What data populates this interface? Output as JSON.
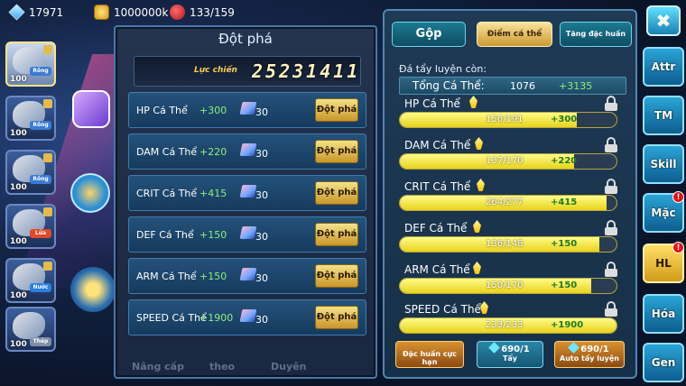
{
  "resources": {
    "diamonds": "17971",
    "gold": "1000000k",
    "stamina": "133/159"
  },
  "roster": [
    {
      "level": "100",
      "type": "Rồng",
      "type_color": "#3a7bd5",
      "element_color": "#e94bd0",
      "selected": true
    },
    {
      "level": "100",
      "type": "Rồng",
      "type_color": "#3a7bd5",
      "element_color": "#ffcc33",
      "selected": false
    },
    {
      "level": "100",
      "type": "Rồng",
      "type_color": "#3a7bd5",
      "element_color": "#e94bd0",
      "selected": false
    },
    {
      "level": "100",
      "type": "Lửa",
      "type_color": "#e04a2a",
      "element_color": "#ffcc33",
      "selected": false
    },
    {
      "level": "100",
      "type": "Nước",
      "type_color": "#2a7fe0",
      "element_color": "#ffcc33",
      "selected": false
    },
    {
      "level": "100",
      "type": "Thép",
      "type_color": "#7f8fa6",
      "element_color": "#ffcc33",
      "selected": false
    }
  ],
  "dot_pha": {
    "title": "Đột phá",
    "power_label": "Lực chiến",
    "power_value": "25231411",
    "rows": [
      {
        "name": "HP Cá Thể",
        "bonus": "+300",
        "cost": "30",
        "button": "Đột phá"
      },
      {
        "name": "DAM Cá Thể",
        "bonus": "+220",
        "cost": "30",
        "button": "Đột phá"
      },
      {
        "name": "CRIT Cá Thể",
        "bonus": "+415",
        "cost": "30",
        "button": "Đột phá"
      },
      {
        "name": "DEF Cá Thể",
        "bonus": "+150",
        "cost": "30",
        "button": "Đột phá"
      },
      {
        "name": "ARM Cá Thể",
        "bonus": "+150",
        "cost": "30",
        "button": "Đột phá"
      },
      {
        "name": "SPEED Cá Thể",
        "bonus": "+1900",
        "cost": "30",
        "button": "Đột phá"
      }
    ],
    "bottom_tabs": [
      "Nâng cấp",
      "theo",
      "Duyên"
    ]
  },
  "right_panel": {
    "tabs": [
      "Gộp",
      "Điểm cá thể",
      "Tăng đặc huấn"
    ],
    "active_tab": 1,
    "remaining_label": "Đá tẩy luyện còn:",
    "total_label": "Tổng Cá Thể:",
    "total_value": "1076",
    "total_plus": "+3135",
    "stats": [
      {
        "name": "HP Cá Thể",
        "progress": "156/191",
        "current": 156,
        "max": 191,
        "plus": "+300"
      },
      {
        "name": "DAM Cá Thể",
        "progress": "137/170",
        "current": 137,
        "max": 170,
        "plus": "+220"
      },
      {
        "name": "CRIT Cá Thể",
        "progress": "264/277",
        "current": 264,
        "max": 277,
        "plus": "+415"
      },
      {
        "name": "DEF Cá Thể",
        "progress": "136/148",
        "current": 136,
        "max": 148,
        "plus": "+150"
      },
      {
        "name": "ARM Cá Thể",
        "progress": "150/170",
        "current": 150,
        "max": 170,
        "plus": "+150"
      },
      {
        "name": "SPEED Cá Thể",
        "progress": "233/233",
        "current": 233,
        "max": 233,
        "plus": "+1900"
      }
    ],
    "buttons": {
      "special_train": "Đặc huấn cực hạn",
      "wash_count": "690/1",
      "wash_label": "Tẩy",
      "auto_count": "690/1",
      "auto_label": "Auto tẩy luyện"
    }
  },
  "side_nav": [
    {
      "label": "Attr",
      "badge": "",
      "highlight": false
    },
    {
      "label": "TM",
      "badge": "",
      "highlight": false
    },
    {
      "label": "Skill",
      "badge": "",
      "highlight": false
    },
    {
      "label": "Mặc",
      "badge": "!",
      "highlight": false
    },
    {
      "label": "HL",
      "badge": "!",
      "highlight": true
    },
    {
      "label": "Hóa",
      "badge": "",
      "highlight": false
    },
    {
      "label": "Gen",
      "badge": "",
      "highlight": false
    }
  ],
  "close_icon": "✖"
}
